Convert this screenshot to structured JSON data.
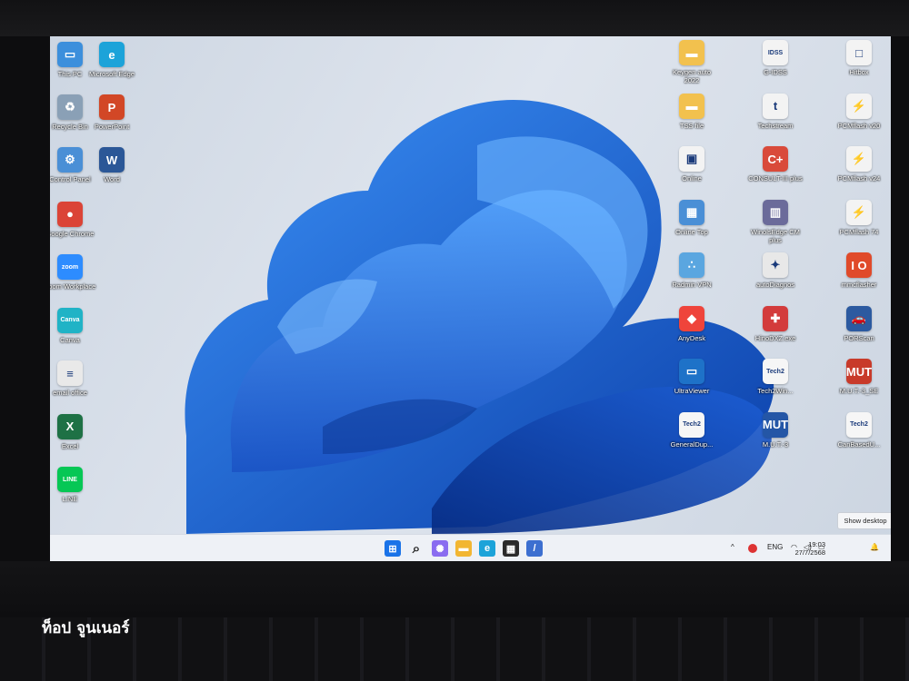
{
  "desktop": {
    "left_icons": [
      {
        "label": "This PC",
        "icon": "computer-icon",
        "color": "#3c8fdc",
        "glyph": "▭"
      },
      {
        "label": "Microsoft Edge",
        "icon": "edge-icon",
        "color": "#1ca3d9",
        "glyph": "e"
      },
      {
        "label": "Recycle Bin",
        "icon": "recycle-bin-icon",
        "color": "#8aa0b6",
        "glyph": "♻"
      },
      {
        "label": "PowerPoint",
        "icon": "powerpoint-icon",
        "color": "#d24726",
        "glyph": "P"
      },
      {
        "label": "Control Panel",
        "icon": "control-panel-icon",
        "color": "#4a8fd6",
        "glyph": "⚙"
      },
      {
        "label": "Word",
        "icon": "word-icon",
        "color": "#2b5797",
        "glyph": "W"
      },
      {
        "label": "Google Chrome",
        "icon": "chrome-icon",
        "color": "#db4437",
        "glyph": "●"
      },
      {
        "label": "Zoom Workplace",
        "icon": "zoom-icon",
        "color": "#2d8cff",
        "glyph": "zoom"
      },
      {
        "label": "Canva",
        "icon": "canva-icon",
        "color": "#20b3c6",
        "glyph": "Canva"
      },
      {
        "label": "email office",
        "icon": "document-icon",
        "color": "#e9e9e9",
        "glyph": "≡"
      },
      {
        "label": "Excel",
        "icon": "excel-icon",
        "color": "#1e7145",
        "glyph": "X"
      },
      {
        "label": "LINE",
        "icon": "line-icon",
        "color": "#06c755",
        "glyph": "LINE"
      }
    ],
    "right_icons": [
      {
        "label": "Keygen auto 2022",
        "icon": "folder-icon",
        "color": "#f2c14e",
        "glyph": "▬"
      },
      {
        "label": "G-IDSS",
        "icon": "g-idss-icon",
        "color": "#f3f3f3",
        "glyph": "IDSS"
      },
      {
        "label": "Hitbox",
        "icon": "hitbox-icon",
        "color": "#f3f3f3",
        "glyph": "□"
      },
      {
        "label": "TSS file",
        "icon": "folder-icon",
        "color": "#f2c14e",
        "glyph": "▬"
      },
      {
        "label": "Techstream",
        "icon": "techstream-icon",
        "color": "#f3f3f3",
        "glyph": "t"
      },
      {
        "label": "PCMflash v20",
        "icon": "pcmflash-icon",
        "color": "#f3f3f3",
        "glyph": "⚡"
      },
      {
        "label": "Online",
        "icon": "online-icon",
        "color": "#f3f3f3",
        "glyph": "▣"
      },
      {
        "label": "CONSULT-III plus",
        "icon": "consult-icon",
        "color": "#d94a3a",
        "glyph": "C+"
      },
      {
        "label": "PCMflash v24",
        "icon": "pcmflash-icon",
        "color": "#f3f3f3",
        "glyph": "⚡"
      },
      {
        "label": "Online Top",
        "icon": "online-top-icon",
        "color": "#4a8fd6",
        "glyph": "▦"
      },
      {
        "label": "WinolsEdge CM plus",
        "icon": "winols-icon",
        "color": "#6b6b9a",
        "glyph": "▥"
      },
      {
        "label": "PCMflash 74",
        "icon": "pcmflash-icon",
        "color": "#f3f3f3",
        "glyph": "⚡"
      },
      {
        "label": "Radmin VPN",
        "icon": "radmin-icon",
        "color": "#5aa6e0",
        "glyph": "∴"
      },
      {
        "label": "autoDiagnos",
        "icon": "autodiag-icon",
        "color": "#e8e8e8",
        "glyph": "✦"
      },
      {
        "label": "mmcflasher",
        "icon": "mmcflasher-icon",
        "color": "#e04a2a",
        "glyph": "I O"
      },
      {
        "label": "AnyDesk",
        "icon": "anydesk-icon",
        "color": "#ef443b",
        "glyph": "◆"
      },
      {
        "label": "HinoDXZ.exe",
        "icon": "hino-icon",
        "color": "#d33b3b",
        "glyph": "✚"
      },
      {
        "label": "PORScan",
        "icon": "forscan-icon",
        "color": "#2c5aa0",
        "glyph": "🚗"
      },
      {
        "label": "UltraViewer",
        "icon": "ultraviewer-icon",
        "color": "#1e72c8",
        "glyph": "▭"
      },
      {
        "label": "Tech2Win...",
        "icon": "tech2win-icon",
        "color": "#f6f6f6",
        "glyph": "Tech2"
      },
      {
        "label": "M.U.T.-3_SE",
        "icon": "mut3-se-icon",
        "color": "#c83a2a",
        "glyph": "MUT"
      },
      {
        "label": "GeneralDup...",
        "icon": "tech2win-icon",
        "color": "#f6f6f6",
        "glyph": "Tech2"
      },
      {
        "label": "M.U.T.-3",
        "icon": "mut3-icon",
        "color": "#2456a6",
        "glyph": "MUT"
      },
      {
        "label": "CanBasedU...",
        "icon": "tech2win-icon",
        "color": "#f6f6f6",
        "glyph": "Tech2"
      }
    ],
    "show_desktop": "Show desktop"
  },
  "taskbar": {
    "apps": [
      {
        "name": "start-button",
        "icon": "windows-icon",
        "color": "#1a73e8",
        "glyph": "⊞"
      },
      {
        "name": "search-button",
        "icon": "search-icon",
        "color": "#eef1f6",
        "glyph": "⌕"
      },
      {
        "name": "copilot-button",
        "icon": "copilot-icon",
        "color": "#8a6cf0",
        "glyph": "✺"
      },
      {
        "name": "file-explorer-button",
        "icon": "folder-icon",
        "color": "#f2b632",
        "glyph": "▬"
      },
      {
        "name": "edge-button",
        "icon": "edge-icon",
        "color": "#1ca3d9",
        "glyph": "e"
      },
      {
        "name": "store-button",
        "icon": "store-icon",
        "color": "#2b2b2b",
        "glyph": "▦"
      },
      {
        "name": "app-button",
        "icon": "app-icon",
        "color": "#3c6fd0",
        "glyph": "/"
      }
    ],
    "tray": {
      "chevron": "^",
      "language": "ENG",
      "wifi": "wifi-icon",
      "volume": "volume-icon",
      "battery": "battery-icon",
      "time": "19:03",
      "date": "27/7/2568",
      "notification": "bell-icon"
    }
  },
  "caption": "ท็อป จูนเนอร์"
}
